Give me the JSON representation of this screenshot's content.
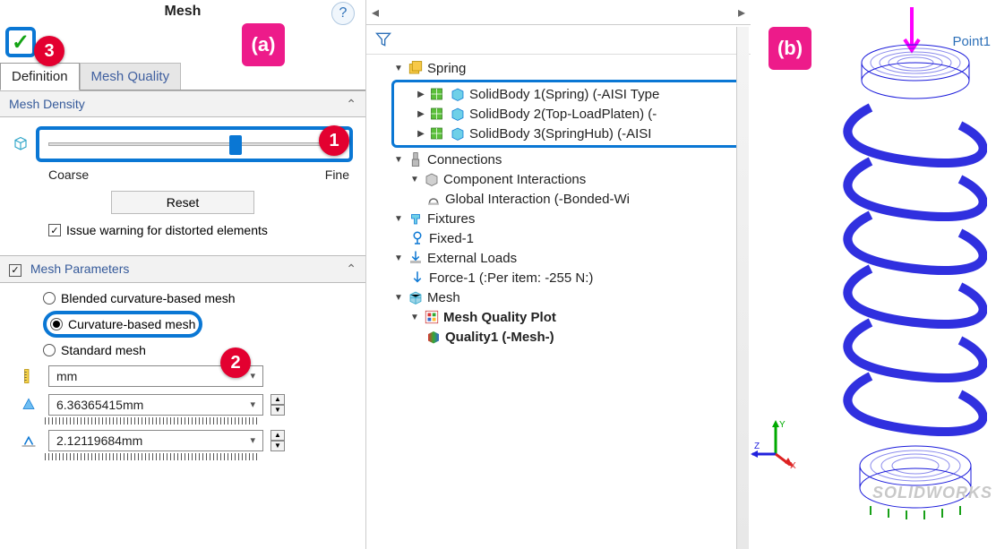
{
  "panel_title": "Mesh",
  "help_tooltip": "?",
  "tabs": {
    "definition": "Definition",
    "quality": "Mesh Quality"
  },
  "density": {
    "title": "Mesh Density",
    "coarse": "Coarse",
    "fine": "Fine",
    "reset": "Reset",
    "warn": "Issue warning for distorted elements"
  },
  "params": {
    "title": "Mesh Parameters",
    "blended": "Blended curvature-based mesh",
    "curvature": "Curvature-based mesh",
    "standard": "Standard mesh",
    "unit": "mm",
    "max_size": "6.36365415mm",
    "min_size": "2.12119684mm"
  },
  "annotations": {
    "a": "(a)",
    "b": "(b)",
    "c1": "1",
    "c2": "2",
    "c3": "3"
  },
  "tree": {
    "root": "Spring",
    "bodies": [
      "SolidBody 1(Spring) (-AISI Type",
      "SolidBody 2(Top-LoadPlaten) (-",
      "SolidBody 3(SpringHub) (-AISI"
    ],
    "connections": "Connections",
    "comp_inter": "Component Interactions",
    "global_int": "Global Interaction (-Bonded-Wi",
    "fixtures": "Fixtures",
    "fixed": "Fixed-1",
    "ext_loads": "External Loads",
    "force": "Force-1 (:Per item: -255 N:)",
    "mesh": "Mesh",
    "mqp": "Mesh Quality Plot",
    "quality1": "Quality1 (-Mesh-)"
  },
  "viewport": {
    "point_label": "Point1",
    "watermark": "SOLIDWORKS"
  },
  "nav": {
    "left": "◂",
    "right": "▸"
  }
}
